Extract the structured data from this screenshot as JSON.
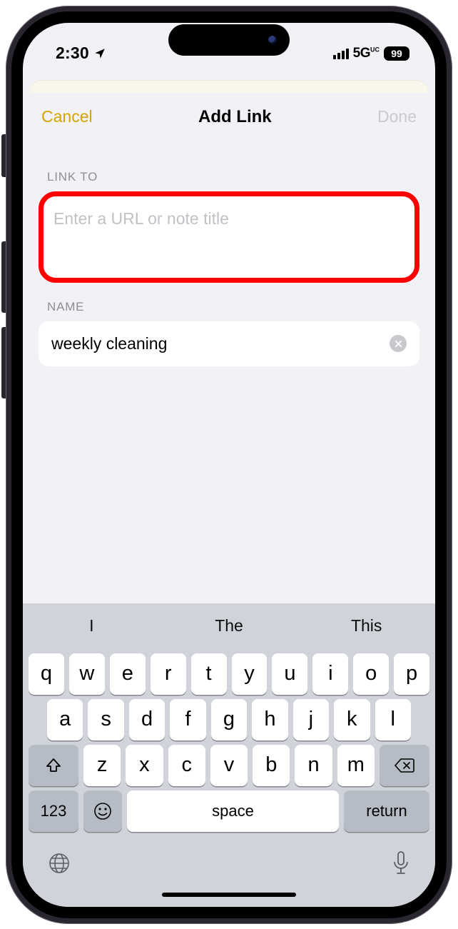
{
  "statusbar": {
    "time": "2:30",
    "network_label": "5G",
    "network_sub": "UC",
    "battery_pct": "99"
  },
  "nav": {
    "cancel": "Cancel",
    "title": "Add Link",
    "done": "Done"
  },
  "form": {
    "link_to_label": "LINK TO",
    "link_to_placeholder": "Enter a URL or note title",
    "link_to_value": "",
    "name_label": "NAME",
    "name_value": "weekly cleaning"
  },
  "keyboard": {
    "suggestions": [
      "I",
      "The",
      "This"
    ],
    "row1": [
      "q",
      "w",
      "e",
      "r",
      "t",
      "y",
      "u",
      "i",
      "o",
      "p"
    ],
    "row2": [
      "a",
      "s",
      "d",
      "f",
      "g",
      "h",
      "j",
      "k",
      "l"
    ],
    "row3": [
      "z",
      "x",
      "c",
      "v",
      "b",
      "n",
      "m"
    ],
    "numbers_key": "123",
    "space_key": "space",
    "return_key": "return"
  },
  "colors": {
    "accent_yellow": "#d6a400",
    "highlight_red": "#fd0100",
    "sheet_bg": "#f2f2f6"
  }
}
